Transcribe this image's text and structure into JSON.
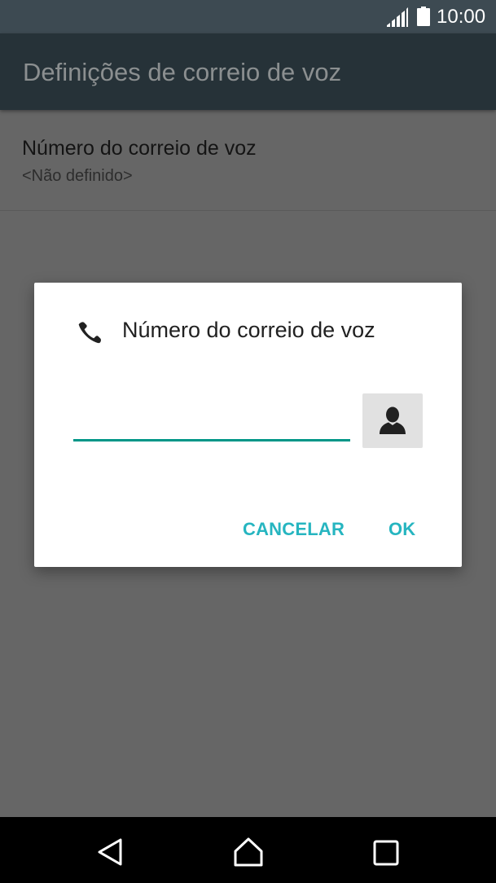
{
  "status_bar": {
    "time": "10:00",
    "icons": [
      "signal-icon",
      "battery-icon"
    ]
  },
  "app_bar": {
    "title": "Definições de correio de voz"
  },
  "preference": {
    "title": "Número do correio de voz",
    "summary": "<Não definido>"
  },
  "dialog": {
    "icon": "phone-icon",
    "title": "Número do correio de voz",
    "input_value": "",
    "contact_icon": "person-icon",
    "cancel_label": "CANCELAR",
    "ok_label": "OK"
  },
  "nav_bar": {
    "icons": [
      "back-icon",
      "home-icon",
      "recents-icon"
    ]
  },
  "colors": {
    "accent": "#26b5c0",
    "input_underline": "#009688",
    "app_bar": "#263238",
    "scrim_background": "#666666"
  }
}
